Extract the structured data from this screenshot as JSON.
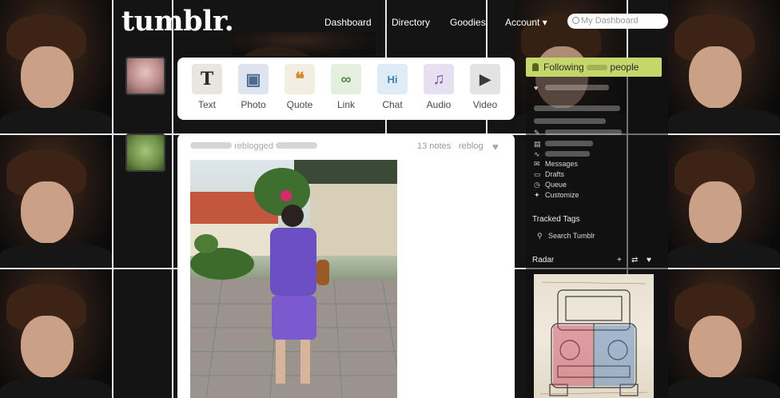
{
  "header": {
    "logo": "tumblr.",
    "nav": {
      "dashboard": "Dashboard",
      "directory": "Directory",
      "goodies": "Goodies",
      "account": "Account ▾"
    },
    "search": {
      "placeholder": "My Dashboard"
    }
  },
  "composer": {
    "types": [
      {
        "label": "Text",
        "glyph": "T",
        "color": "#e8e6df"
      },
      {
        "label": "Photo",
        "glyph": "▣",
        "color": "#dde4ee"
      },
      {
        "label": "Quote",
        "glyph": "❝",
        "color": "#f3eee2"
      },
      {
        "label": "Link",
        "glyph": "∞",
        "color": "#e4f0df"
      },
      {
        "label": "Chat",
        "glyph": "Hi",
        "color": "#e0ecf5"
      },
      {
        "label": "Audio",
        "glyph": "♫",
        "color": "#e6e0f0"
      },
      {
        "label": "Video",
        "glyph": "▶",
        "color": "#e3e3e3"
      }
    ]
  },
  "post": {
    "action": "reblogged",
    "notes": "13 notes",
    "reblog": "reblog"
  },
  "sidebar": {
    "following": "Following",
    "following_suffix": "people",
    "items": {
      "messages": "Messages",
      "drafts": "Drafts",
      "queue": "Queue",
      "customize": "Customize"
    },
    "tracked_tags": "Tracked Tags",
    "search": "Search Tumblr",
    "radar": "Radar"
  },
  "colors": {
    "follow_bar": "#c5d66a",
    "page_bg": "#141414"
  }
}
